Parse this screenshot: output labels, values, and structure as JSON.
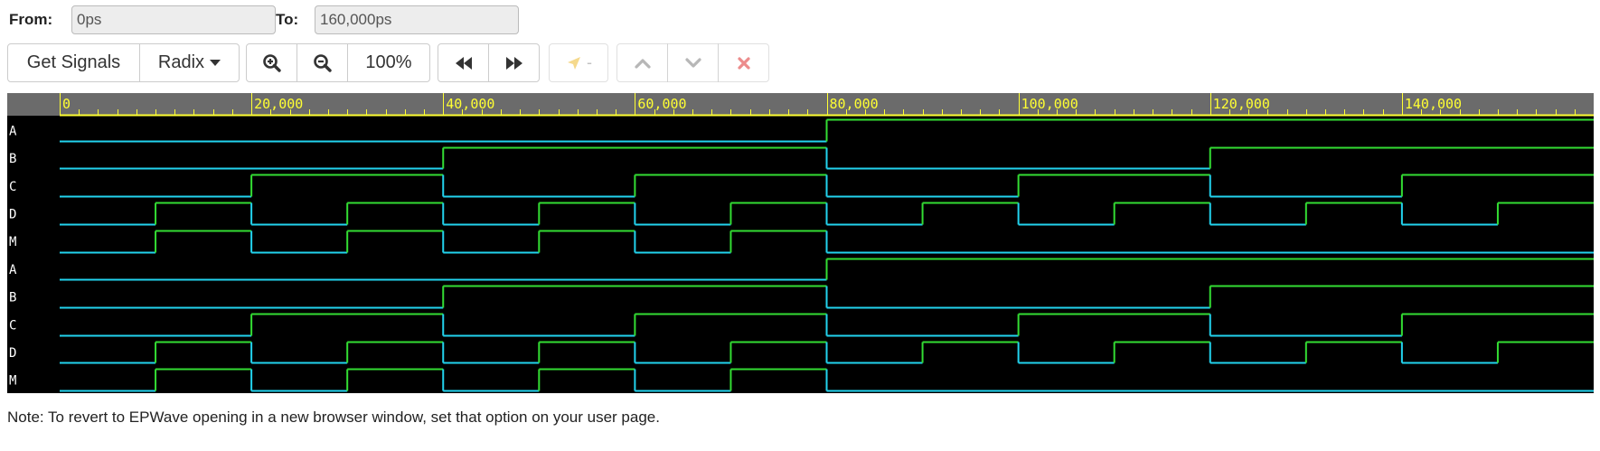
{
  "range": {
    "from_label": "From:",
    "from_value": "0ps",
    "to_label": "To:",
    "to_value": "160,000ps"
  },
  "toolbar": {
    "get_signals_label": "Get Signals",
    "radix_label": "Radix",
    "zoom_in_icon": "zoom-in-icon",
    "zoom_out_icon": "zoom-out-icon",
    "zoom_level": "100%",
    "jump_back_icon": "fast-backward-icon",
    "jump_forward_icon": "fast-forward-icon",
    "cursor_icon": "location-arrow-icon",
    "cursor_value": "-",
    "move_up_icon": "chevron-up-icon",
    "move_down_icon": "chevron-down-icon",
    "remove_icon": "close-icon"
  },
  "waveform": {
    "time_start": 0,
    "time_end": 160000,
    "ruler_labels": [
      "0",
      "20,000",
      "40,000",
      "60,000",
      "80,000",
      "100,000",
      "120,000",
      "140,000"
    ],
    "ruler_times": [
      0,
      20000,
      40000,
      60000,
      80000,
      100000,
      120000,
      140000
    ],
    "colors": {
      "background": "#000000",
      "ruler_bg": "#6b6b6b",
      "ruler_text": "#ffff33",
      "low": "#22d3ee",
      "high": "#33dd33",
      "signal_label": "#ffffff"
    },
    "signals": [
      {
        "name": "A",
        "transitions": [
          [
            0,
            0
          ],
          [
            80000,
            1
          ]
        ]
      },
      {
        "name": "B",
        "transitions": [
          [
            0,
            0
          ],
          [
            40000,
            1
          ],
          [
            80000,
            0
          ],
          [
            120000,
            1
          ]
        ]
      },
      {
        "name": "C",
        "transitions": [
          [
            0,
            0
          ],
          [
            20000,
            1
          ],
          [
            40000,
            0
          ],
          [
            60000,
            1
          ],
          [
            80000,
            0
          ],
          [
            100000,
            1
          ],
          [
            120000,
            0
          ],
          [
            140000,
            1
          ]
        ]
      },
      {
        "name": "D",
        "transitions": [
          [
            0,
            0
          ],
          [
            10000,
            1
          ],
          [
            20000,
            0
          ],
          [
            30000,
            1
          ],
          [
            40000,
            0
          ],
          [
            50000,
            1
          ],
          [
            60000,
            0
          ],
          [
            70000,
            1
          ],
          [
            80000,
            0
          ],
          [
            90000,
            1
          ],
          [
            100000,
            0
          ],
          [
            110000,
            1
          ],
          [
            120000,
            0
          ],
          [
            130000,
            1
          ],
          [
            140000,
            0
          ],
          [
            150000,
            1
          ]
        ]
      },
      {
        "name": "M",
        "transitions": [
          [
            0,
            0
          ],
          [
            10000,
            1
          ],
          [
            20000,
            0
          ],
          [
            30000,
            1
          ],
          [
            40000,
            0
          ],
          [
            50000,
            1
          ],
          [
            60000,
            0
          ],
          [
            70000,
            1
          ],
          [
            80000,
            0
          ]
        ]
      },
      {
        "name": "A",
        "transitions": [
          [
            0,
            0
          ],
          [
            80000,
            1
          ]
        ]
      },
      {
        "name": "B",
        "transitions": [
          [
            0,
            0
          ],
          [
            40000,
            1
          ],
          [
            80000,
            0
          ],
          [
            120000,
            1
          ]
        ]
      },
      {
        "name": "C",
        "transitions": [
          [
            0,
            0
          ],
          [
            20000,
            1
          ],
          [
            40000,
            0
          ],
          [
            60000,
            1
          ],
          [
            80000,
            0
          ],
          [
            100000,
            1
          ],
          [
            120000,
            0
          ],
          [
            140000,
            1
          ]
        ]
      },
      {
        "name": "D",
        "transitions": [
          [
            0,
            0
          ],
          [
            10000,
            1
          ],
          [
            20000,
            0
          ],
          [
            30000,
            1
          ],
          [
            40000,
            0
          ],
          [
            50000,
            1
          ],
          [
            60000,
            0
          ],
          [
            70000,
            1
          ],
          [
            80000,
            0
          ],
          [
            90000,
            1
          ],
          [
            100000,
            0
          ],
          [
            110000,
            1
          ],
          [
            120000,
            0
          ],
          [
            130000,
            1
          ],
          [
            140000,
            0
          ],
          [
            150000,
            1
          ]
        ]
      },
      {
        "name": "M",
        "transitions": [
          [
            0,
            0
          ],
          [
            10000,
            1
          ],
          [
            20000,
            0
          ],
          [
            30000,
            1
          ],
          [
            40000,
            0
          ],
          [
            50000,
            1
          ],
          [
            60000,
            0
          ],
          [
            70000,
            1
          ],
          [
            80000,
            0
          ]
        ]
      }
    ]
  },
  "note": "Note: To revert to EPWave opening in a new browser window, set that option on your user page."
}
